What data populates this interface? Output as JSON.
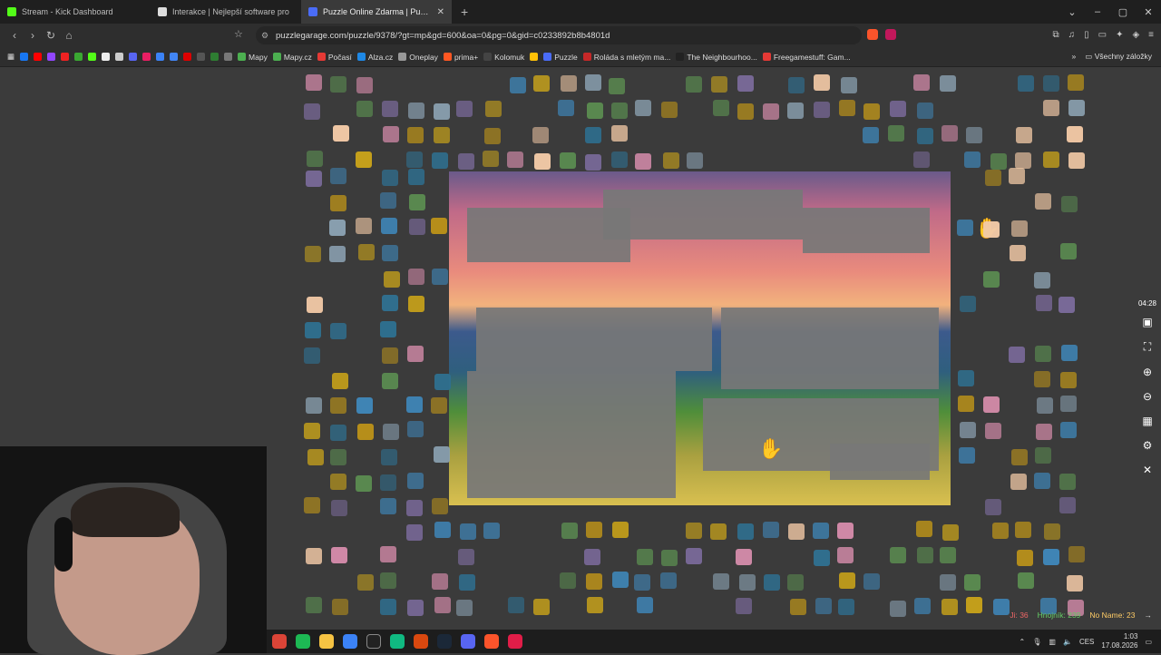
{
  "tabs": [
    {
      "title": "Stream - Kick Dashboard",
      "icon_color": "#53fc18"
    },
    {
      "title": "Interakce | Nejlepší software pro",
      "icon_color": "#dddddd"
    },
    {
      "title": "Puzzle Online Zdarma | Puzzle",
      "icon_color": "#4a6cf7"
    }
  ],
  "newtab": "+",
  "window_controls": {
    "collapse": "⌄",
    "minimize": "–",
    "maximize": "▢",
    "close": "✕"
  },
  "nav": {
    "back": "‹",
    "forward": "›",
    "reload": "↻",
    "home": "⌂"
  },
  "url": "puzzlegarage.com/puzzle/9378/?gt=mp&gd=600&oa=0&pg=0&gid=c0233892b8b4801d",
  "bookmarks": [
    {
      "label": "",
      "color": "#1877f2"
    },
    {
      "label": "",
      "color": "#ff0000"
    },
    {
      "label": "",
      "color": "#9146ff"
    },
    {
      "label": "",
      "color": "#e22"
    },
    {
      "label": "",
      "color": "#3aa832"
    },
    {
      "label": "",
      "color": "#53fc18"
    },
    {
      "label": "",
      "color": "#eee"
    },
    {
      "label": "",
      "color": "#ccc"
    },
    {
      "label": "",
      "color": "#5865f2"
    },
    {
      "label": "",
      "color": "#e91e63"
    },
    {
      "label": "",
      "color": "#3b82f6"
    },
    {
      "label": "",
      "color": "#4285f4"
    },
    {
      "label": "",
      "color": "#d00"
    },
    {
      "label": "",
      "color": "#555"
    },
    {
      "label": "",
      "color": "#2e7d32"
    },
    {
      "label": "",
      "color": "#777"
    },
    {
      "label": "Mapy",
      "color": "#4caf50"
    },
    {
      "label": "Mapy.cz",
      "color": "#4caf50"
    },
    {
      "label": "Počasí",
      "color": "#e53935"
    },
    {
      "label": "Alza.cz",
      "color": "#1e88e5"
    },
    {
      "label": "Oneplay",
      "color": "#999"
    },
    {
      "label": "prima+",
      "color": "#ff5722"
    },
    {
      "label": "Kolomuk",
      "color": "#444"
    },
    {
      "label": "",
      "color": "#ffc107"
    },
    {
      "label": "Puzzle",
      "color": "#4a6cf7"
    },
    {
      "label": "Roláda s mletým ma...",
      "color": "#c62828"
    },
    {
      "label": "The Neighbourhoo...",
      "color": "#222"
    },
    {
      "label": "Freegamestuff: Gam...",
      "color": "#e53935"
    }
  ],
  "bookmarks_more": "»",
  "all_bookmarks": "Všechny záložky",
  "timer": "04:28",
  "side_tools": [
    "image-icon",
    "fullscreen-icon",
    "zoom-in-icon",
    "zoom-out-icon",
    "grid-icon",
    "settings-icon",
    "close-icon"
  ],
  "status": {
    "player1": "Ji: 36",
    "player2": "Hnojník: 239",
    "player3": "No Name: 23"
  },
  "taskbar": {
    "time": "1:03",
    "date": "17.08.2026",
    "lang": "CES"
  },
  "colors": {
    "tab_active": "#3a3a3a",
    "stage": "#3b3b3b",
    "accent": "#4a6cf7"
  }
}
